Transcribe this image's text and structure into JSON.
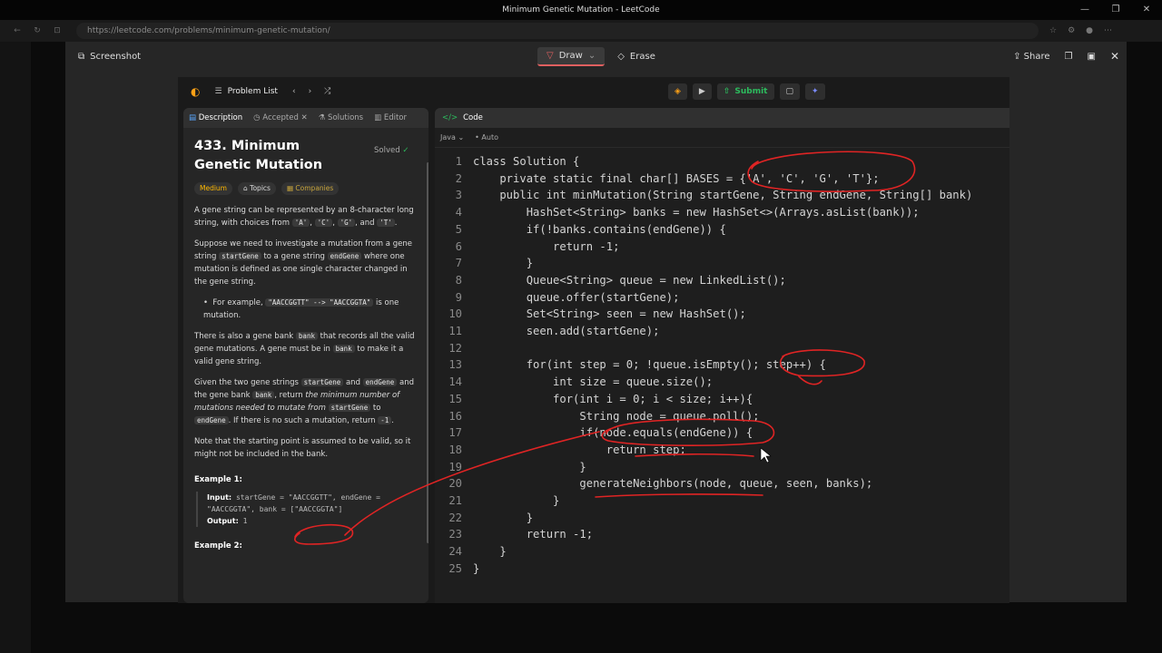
{
  "window": {
    "title": "Minimum Genetic Mutation - LeetCode"
  },
  "browser": {
    "url": "https://leetcode.com/problems/minimum-genetic-mutation/"
  },
  "snip": {
    "label": "Screenshot",
    "draw": "Draw",
    "erase": "Erase",
    "share": "Share"
  },
  "lc": {
    "problem_list": "Problem List",
    "submit": "Submit"
  },
  "tabs": {
    "description": "Description",
    "accepted": "Accepted",
    "solutions": "Solutions",
    "editorial": "Editor",
    "code": "Code"
  },
  "problem": {
    "title": "433. Minimum Genetic Mutation",
    "status": "Solved",
    "difficulty": "Medium",
    "topics": "Topics",
    "companies": "Companies",
    "p1a": "A gene string can be represented by an 8-character long string, with choices from ",
    "chars": [
      "'A'",
      "'C'",
      "'G'",
      "'T'"
    ],
    "p2a": "Suppose we need to investigate a mutation from a gene string ",
    "p2b": " to a gene string ",
    "p2c": " where one mutation is defined as one single character changed in the gene string.",
    "bullet_a": "For example, ",
    "bullet_code": "\"AACCGGTT\" --> \"AACCGGTA\"",
    "bullet_b": " is one mutation.",
    "p3a": "There is also a gene bank ",
    "p3b": " that records all the valid gene mutations. A gene must be in ",
    "p3c": " to make it a valid gene string.",
    "p4a": "Given the two gene strings ",
    "p4b": " and ",
    "p4c": " and the gene bank ",
    "p4d": ", return ",
    "p4e": "the minimum number of mutations needed to mutate from ",
    "p4f": " to ",
    "p4g": ". If there is no such a mutation, return ",
    "p5": "Note that the starting point is assumed to be valid, so it might not be included in the bank.",
    "ex1": "Example 1:",
    "ex1_input": "startGene = \"AACCGGTT\", endGene = \"AACCGGTA\", bank = [\"AACCGGTA\"]",
    "ex1_output": "1",
    "ex2": "Example 2:",
    "startGene": "startGene",
    "endGene": "endGene",
    "bank": "bank",
    "neg1": "-1"
  },
  "editor": {
    "language": "Java",
    "mode": "Auto"
  },
  "code": [
    "class Solution {",
    "    private static final char[] BASES = {'A', 'C', 'G', 'T'};",
    "    public int minMutation(String startGene, String endGene, String[] bank)",
    "        HashSet<String> banks = new HashSet<>(Arrays.asList(bank));",
    "        if(!banks.contains(endGene)) {",
    "            return -1;",
    "        }",
    "        Queue<String> queue = new LinkedList();",
    "        queue.offer(startGene);",
    "        Set<String> seen = new HashSet();",
    "        seen.add(startGene);",
    "",
    "        for(int step = 0; !queue.isEmpty(); step++) {",
    "            int size = queue.size();",
    "            for(int i = 0; i < size; i++){",
    "                String node = queue.poll();",
    "                if(node.equals(endGene)) {",
    "                    return step;",
    "                }",
    "                generateNeighbors(node, queue, seen, banks);",
    "            }",
    "        }",
    "        return -1;",
    "    }",
    "}"
  ],
  "line_numbers": [
    "1",
    "2",
    "3",
    "4",
    "5",
    "6",
    "7",
    "8",
    "9",
    "10",
    "11",
    "12",
    "13",
    "14",
    "15",
    "16",
    "17",
    "18",
    "19",
    "20",
    "21",
    "22",
    "23",
    "24",
    "25"
  ],
  "labels": {
    "input": "Input:",
    "output": "Output:"
  },
  "colors": {
    "accent": "#ffa116",
    "submit": "#2cbb5d",
    "annotation": "#e02424"
  }
}
